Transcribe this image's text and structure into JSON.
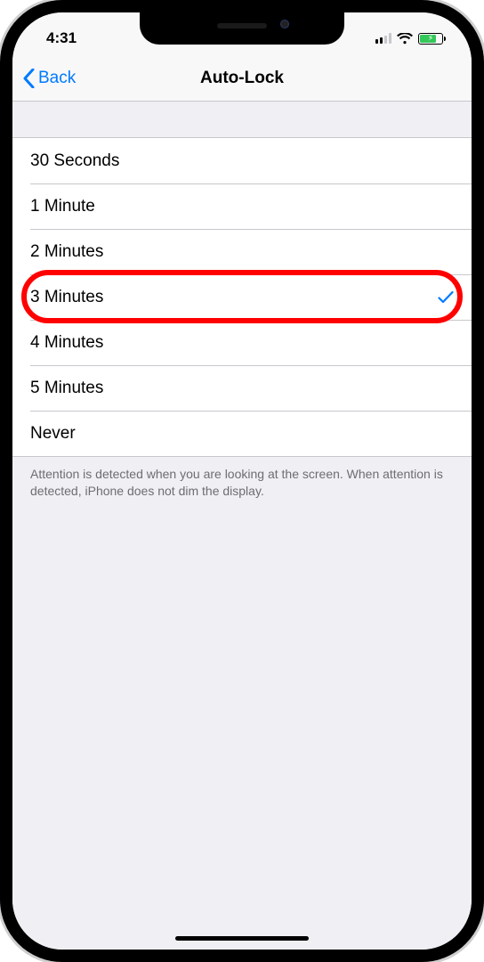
{
  "status": {
    "time": "4:31"
  },
  "nav": {
    "back_label": "Back",
    "title": "Auto-Lock"
  },
  "options": [
    {
      "label": "30 Seconds",
      "selected": false
    },
    {
      "label": "1 Minute",
      "selected": false
    },
    {
      "label": "2 Minutes",
      "selected": false
    },
    {
      "label": "3 Minutes",
      "selected": true,
      "highlighted": true
    },
    {
      "label": "4 Minutes",
      "selected": false
    },
    {
      "label": "5 Minutes",
      "selected": false
    },
    {
      "label": "Never",
      "selected": false
    }
  ],
  "footer": {
    "note": "Attention is detected when you are looking at the screen. When attention is detected, iPhone does not dim the display."
  }
}
